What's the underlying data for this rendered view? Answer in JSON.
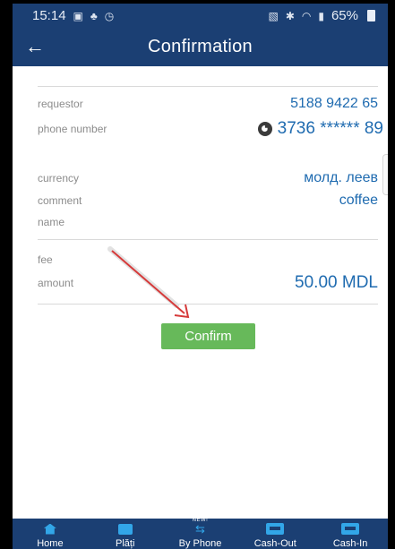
{
  "statusbar": {
    "time": "15:14",
    "battery": "65%"
  },
  "appbar": {
    "title": "Confirmation"
  },
  "details": {
    "requestor": {
      "label": "requestor",
      "value": "5188 9422 65"
    },
    "phone": {
      "label": "phone number",
      "value": "3736 ****** 89"
    },
    "currency": {
      "label": "currency",
      "value": "молд. леев"
    },
    "comment": {
      "label": "comment",
      "value": "coffee"
    },
    "name": {
      "label": "name",
      "value": ""
    },
    "fee": {
      "label": "fee",
      "value": ""
    },
    "amount": {
      "label": "amount",
      "value": "50.00 MDL"
    }
  },
  "confirm_label": "Confirm",
  "bottom_nav": [
    {
      "label": "Home",
      "icon": "home-icon"
    },
    {
      "label": "Plăți",
      "icon": "wallet-icon"
    },
    {
      "label": "By Phone",
      "icon": "transfer-icon",
      "badge": "NEW!"
    },
    {
      "label": "Cash-Out",
      "icon": "atm-out-icon"
    },
    {
      "label": "Cash-In",
      "icon": "atm-in-icon"
    }
  ],
  "colors": {
    "bar": "#1b3f73",
    "value_text": "#1f6bb0",
    "confirm_button": "#67b95a",
    "nav_icon": "#32a6e8",
    "arrow": "#d63a3a"
  }
}
